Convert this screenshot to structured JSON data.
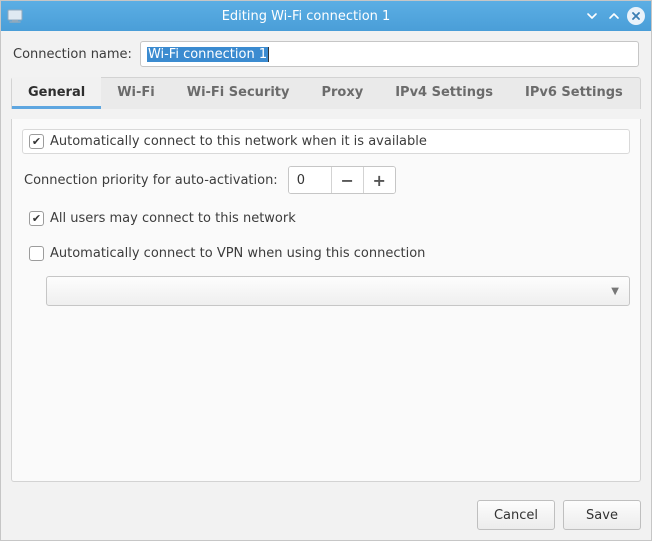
{
  "window": {
    "title": "Editing Wi-Fi connection 1"
  },
  "connection_name": {
    "label": "Connection name:",
    "value": "Wi-Fi connection 1"
  },
  "tabs": {
    "general": "General",
    "wifi": "Wi-Fi",
    "wifi_security": "Wi-Fi Security",
    "proxy": "Proxy",
    "ipv4": "IPv4 Settings",
    "ipv6": "IPv6 Settings"
  },
  "general": {
    "auto_connect_label": "Automatically connect to this network when it is available",
    "auto_connect_checked": true,
    "priority_label": "Connection priority for auto-activation:",
    "priority_value": "0",
    "all_users_label": "All users may connect to this network",
    "all_users_checked": true,
    "auto_vpn_label": "Automatically connect to VPN when using this connection",
    "auto_vpn_checked": false,
    "vpn_selected": ""
  },
  "footer": {
    "cancel": "Cancel",
    "save": "Save"
  }
}
